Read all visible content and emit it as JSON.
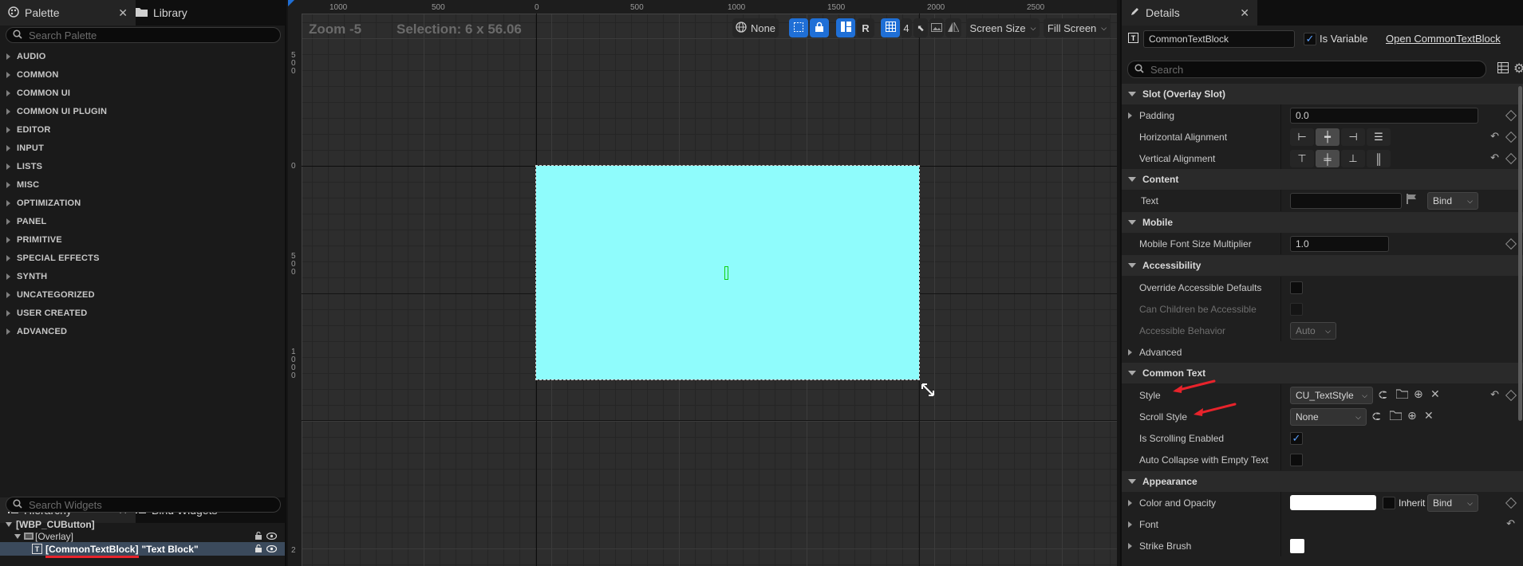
{
  "palette": {
    "tab_label": "Palette",
    "library_tab_label": "Library",
    "search_placeholder": "Search Palette",
    "categories": [
      "AUDIO",
      "COMMON",
      "COMMON UI",
      "COMMON UI PLUGIN",
      "EDITOR",
      "INPUT",
      "LISTS",
      "MISC",
      "OPTIMIZATION",
      "PANEL",
      "PRIMITIVE",
      "SPECIAL EFFECTS",
      "SYNTH",
      "UNCATEGORIZED",
      "USER CREATED",
      "ADVANCED"
    ]
  },
  "hierarchy": {
    "tab_label": "Hierarchy",
    "bind_tab_label": "Bind Widgets",
    "search_placeholder": "Search Widgets",
    "root": "[WBP_CUButton]",
    "overlay": "[Overlay]",
    "selected_widget": "[CommonTextBlock]",
    "selected_widget_text": "\"Text Block\""
  },
  "viewport": {
    "zoom_text": "Zoom -5",
    "selection_text": "Selection: 6 x 56.06",
    "ruler_top_labels": [
      "1000",
      "500",
      "0",
      "500",
      "1000",
      "1500",
      "2000",
      "2500"
    ],
    "ruler_left_labels": [
      "500",
      "0",
      "500",
      "1000",
      "2"
    ],
    "toolbar": {
      "none_label": "None",
      "r_label": "R",
      "grid_value": "4",
      "screen_size_label": "Screen Size",
      "fill_screen_label": "Fill Screen"
    },
    "canvas_color": "#8ffcfc",
    "accent_color": "#1f6fd6"
  },
  "details": {
    "tab_label": "Details",
    "widget_name": "CommonTextBlock",
    "is_variable_label": "Is Variable",
    "is_variable_checked": true,
    "open_link": "Open CommonTextBlock",
    "search_placeholder": "Search",
    "sections": {
      "slot": "Slot (Overlay Slot)",
      "content": "Content",
      "mobile": "Mobile",
      "accessibility": "Accessibility",
      "advanced": "Advanced",
      "common_text": "Common Text",
      "appearance": "Appearance"
    },
    "props": {
      "padding_label": "Padding",
      "padding_value": "0.0",
      "halign_label": "Horizontal Alignment",
      "valign_label": "Vertical Alignment",
      "text_label": "Text",
      "text_value": "",
      "bind_label": "Bind",
      "mobile_font_label": "Mobile Font Size Multiplier",
      "mobile_font_value": "1.0",
      "override_access_label": "Override Accessible Defaults",
      "can_children_label": "Can Children be Accessible",
      "access_behavior_label": "Accessible Behavior",
      "access_behavior_value": "Auto",
      "style_label": "Style",
      "style_value": "CU_TextStyle",
      "scroll_style_label": "Scroll Style",
      "scroll_style_value": "None",
      "is_scrolling_label": "Is Scrolling Enabled",
      "auto_collapse_label": "Auto Collapse with Empty Text",
      "color_label": "Color and Opacity",
      "inherit_label": "Inherit",
      "font_label": "Font",
      "strike_label": "Strike Brush"
    },
    "annotation_color": "#e8232b"
  }
}
